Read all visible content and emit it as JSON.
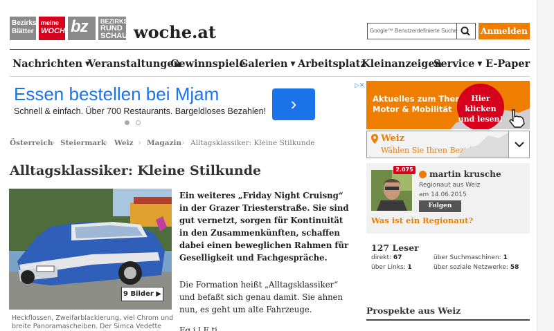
{
  "logos": {
    "bezirksblaetter": "Bezirks Blätter",
    "meinewoche_top": "meine",
    "meinewoche_bottom": "WOCHE",
    "bz": "bz",
    "rundschau_top": "BEZIRKS",
    "rundschau_bottom": "RUND SCHAU"
  },
  "site_title": "woche.at",
  "search": {
    "placeholder": "Google™ Benutzerdefinierte Suche"
  },
  "login_button": "Anmelden",
  "nav": [
    {
      "label": "Nachrichten",
      "dropdown": true
    },
    {
      "label": "Veranstaltungen",
      "dropdown": false
    },
    {
      "label": "Gewinnspiele",
      "dropdown": false
    },
    {
      "label": "Galerien",
      "dropdown": true
    },
    {
      "label": "Arbeitsplatz",
      "dropdown": false
    },
    {
      "label": "Kleinanzeigen",
      "dropdown": false
    },
    {
      "label": "Service",
      "dropdown": true
    },
    {
      "label": "E-Paper",
      "dropdown": false
    }
  ],
  "ad": {
    "title": "Essen bestellen bei Mjam",
    "subtitle": "Schnell & einfach. Über 700 Restaurants. Bargeldloses Bezahlen!",
    "arrow": "›",
    "close": "▷✕"
  },
  "banner": {
    "line1": "Aktuelles zum Thema",
    "line2": "Motor & Mobilität",
    "circle1": "Hier klicken",
    "circle2": "und lesen!"
  },
  "location": {
    "name": "Weiz",
    "subtitle": "Wählen Sie Ihren Bezirk"
  },
  "breadcrumb": [
    "Österreich",
    "Steiermark",
    "Weiz",
    "Magazin",
    "Alltagsklassiker: Kleine Stilkunde"
  ],
  "article": {
    "title": "Alltagsklassiker: Kleine Stilkunde",
    "gallery_button": "9 Bilder",
    "caption": "Heckflossen, Zweifarblackierung, viel Chrom und breite Panoramascheiben. Der Simca Vedette",
    "lead": "Ein weiteres „Friday Night Cruisng“ in der Grazer Triesterstraße. Sie sind gut vernetzt, sorgen für Kontinuität in den Zusammenkünften, schaffen dabei einen beweglichen Rahmen für Geselligkeit und Fachgespräche.",
    "paragraph2": "Die Formation heißt „Alltagsklassiker“ und befaßt sich genau damit. Sie ahnen nun, es geht um alte Fahrzeuge.",
    "paragraph3": "Eg i l F ti"
  },
  "author": {
    "badge": "2.075",
    "name": "martin krusche",
    "role": "Regionaut aus Weiz",
    "since": "am 14.06.2015",
    "follow": "Folgen",
    "regionaut_link": "Was ist ein Regionaut?"
  },
  "stats": {
    "readers": "127 Leser",
    "direct_label": "direkt:",
    "direct": "67",
    "links_label": "über Links:",
    "links": "1",
    "search_label": "über Suchmaschinen:",
    "search": "1",
    "social_label": "über soziale Netzwerke:",
    "social": "58"
  },
  "prospekte_title": "Prospekte aus Weiz",
  "colors": {
    "accent": "#ef7d00",
    "red": "#d6001c",
    "ad_blue": "#1a73e8"
  }
}
